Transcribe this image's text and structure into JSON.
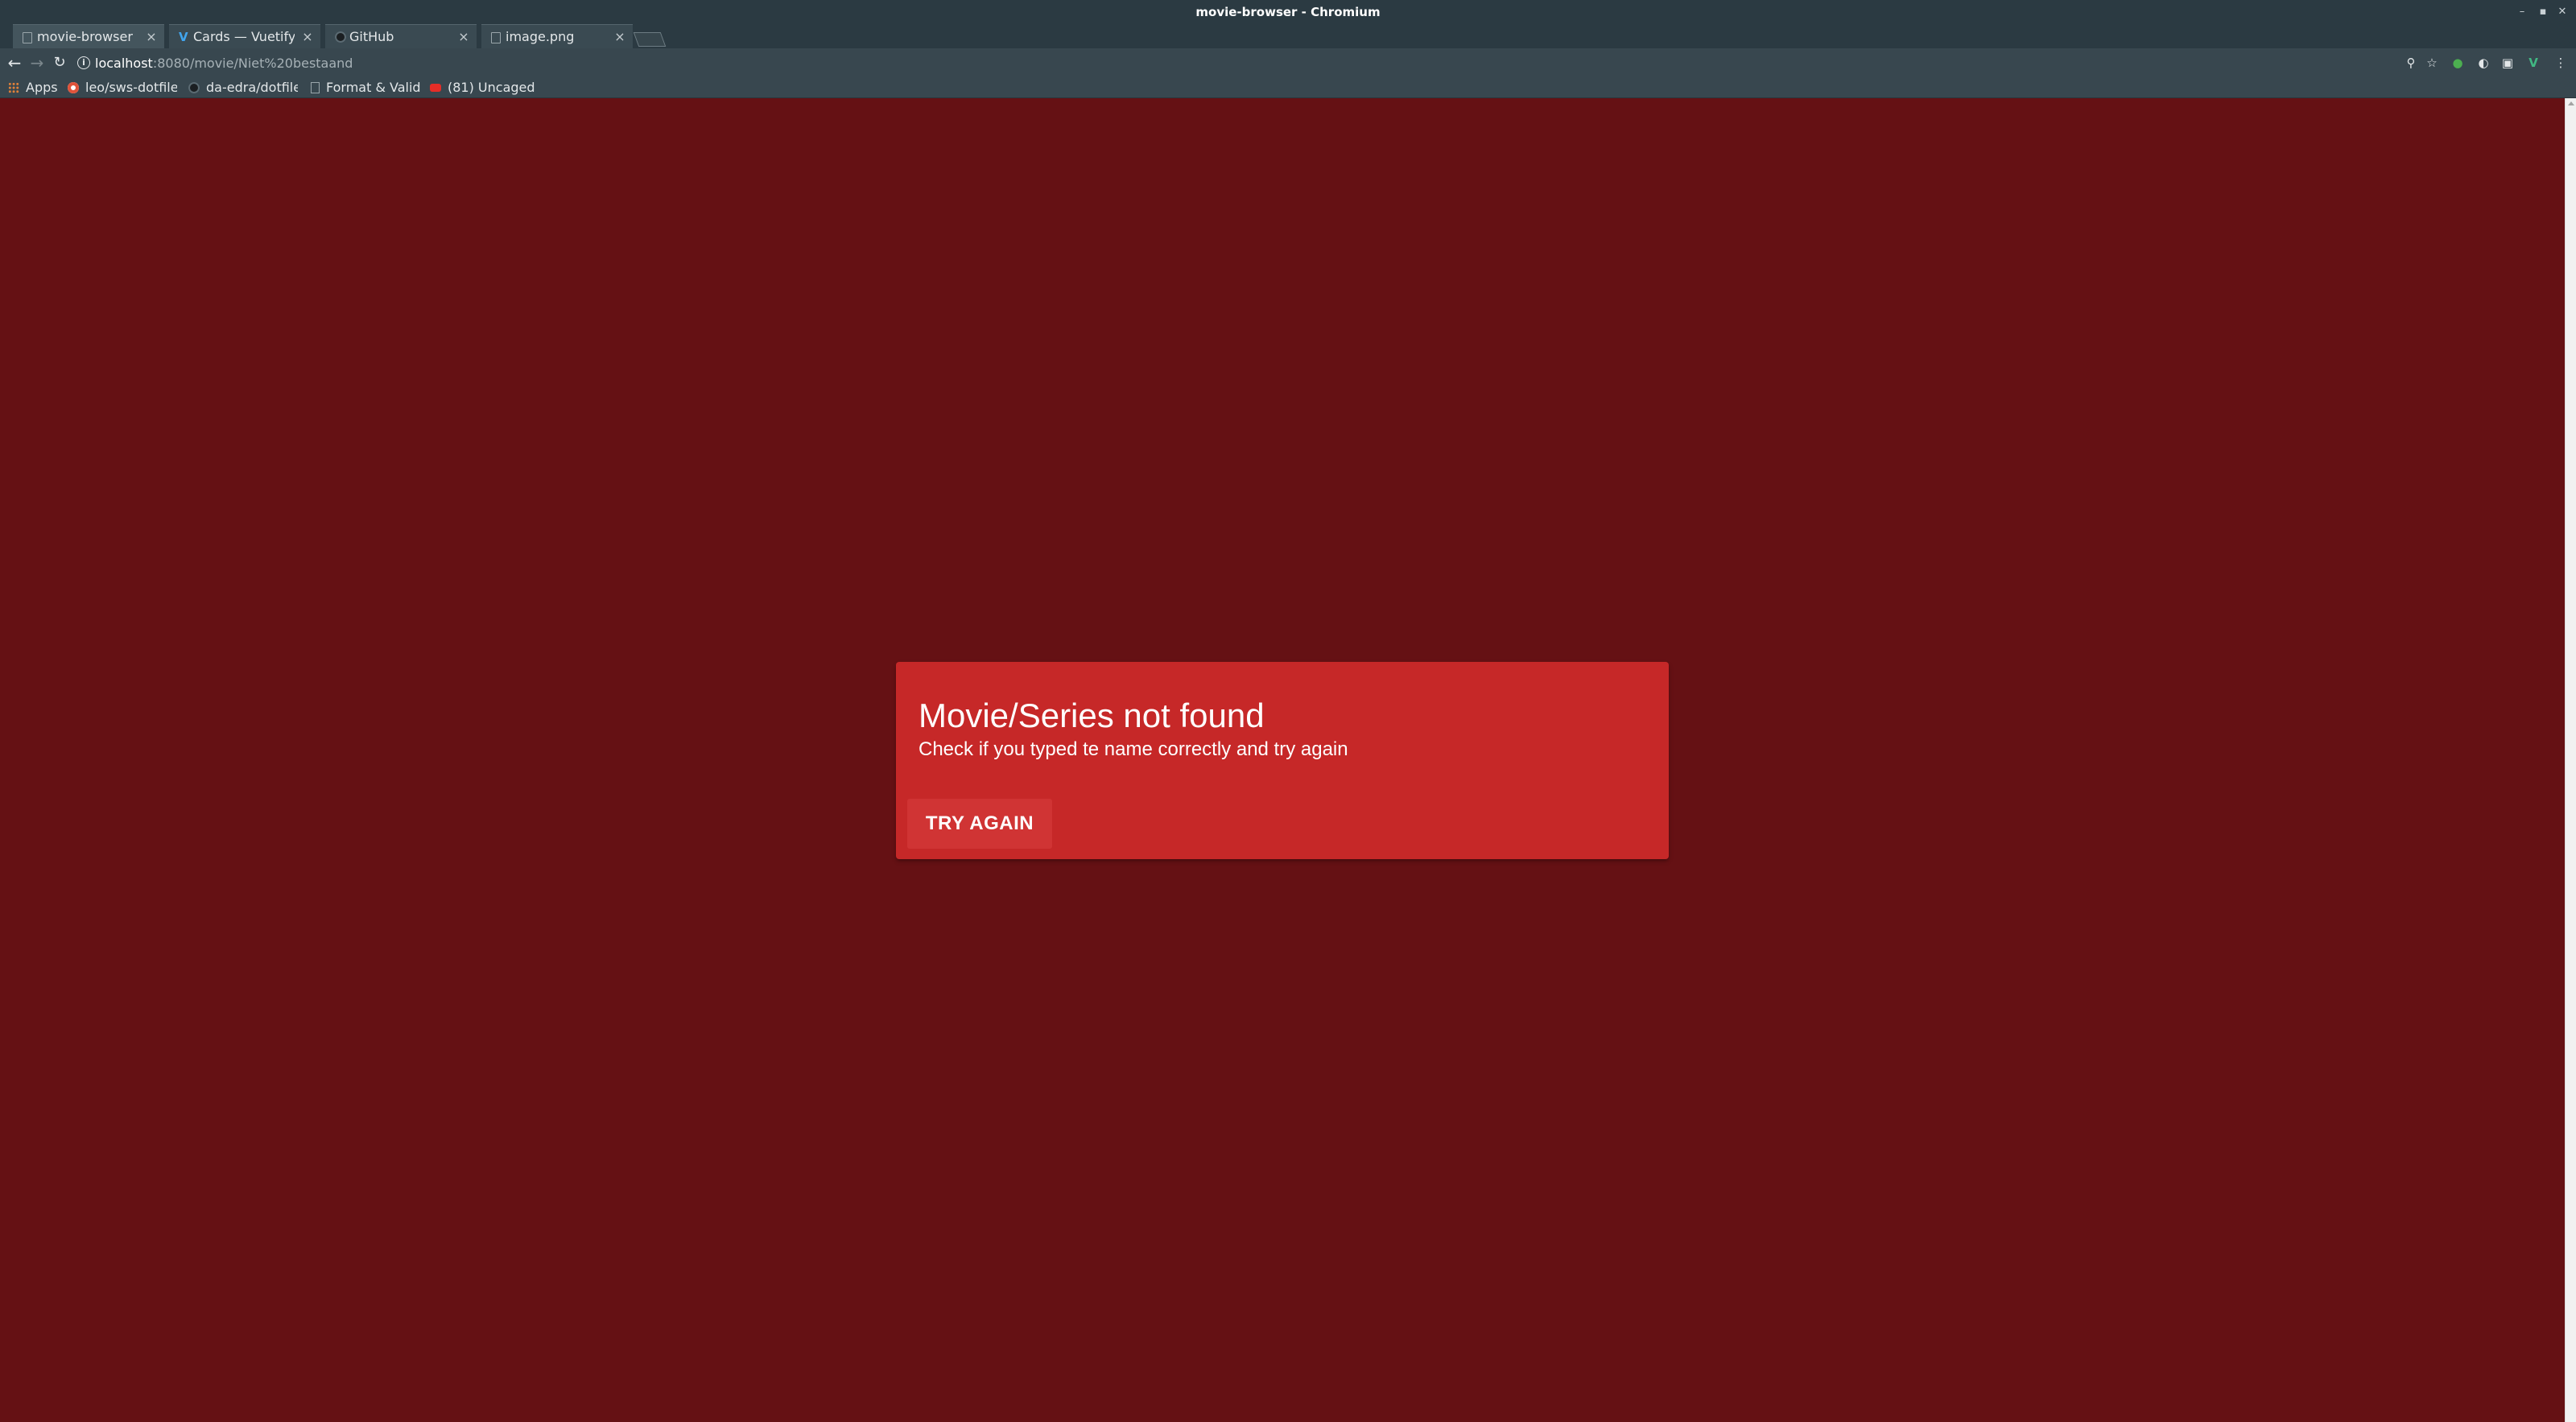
{
  "window": {
    "title": "movie-browser - Chromium"
  },
  "tabs": [
    {
      "label": "movie-browser",
      "favicon": "doc-icon"
    },
    {
      "label": "Cards — Vuetify.js",
      "favicon": "vuetify-icon"
    },
    {
      "label": "GitHub",
      "favicon": "github-icon"
    },
    {
      "label": "image.png",
      "favicon": "doc-icon"
    }
  ],
  "address": {
    "host": "localhost",
    "path": ":8080/movie/Niet%20bestaand"
  },
  "bookmarks": [
    {
      "label": "Apps",
      "icon": "apps-icon"
    },
    {
      "label": "leo/sws-dotfiles",
      "icon": "gear-icon"
    },
    {
      "label": "da-edra/dotfiles",
      "icon": "github-icon"
    },
    {
      "label": "Format & Validate",
      "icon": "doc-icon"
    },
    {
      "label": "(81) Uncaged",
      "icon": "youtube-icon"
    }
  ],
  "card": {
    "heading": "Movie/Series not found",
    "subheading": "Check if you typed te name correctly and try again",
    "button": "TRY AGAIN"
  },
  "colors": {
    "page_background": "#651114",
    "card_background": "#c62828",
    "button_background": "#d03434",
    "chrome_frame": "#2b3a42",
    "toolbar": "#38474f"
  }
}
